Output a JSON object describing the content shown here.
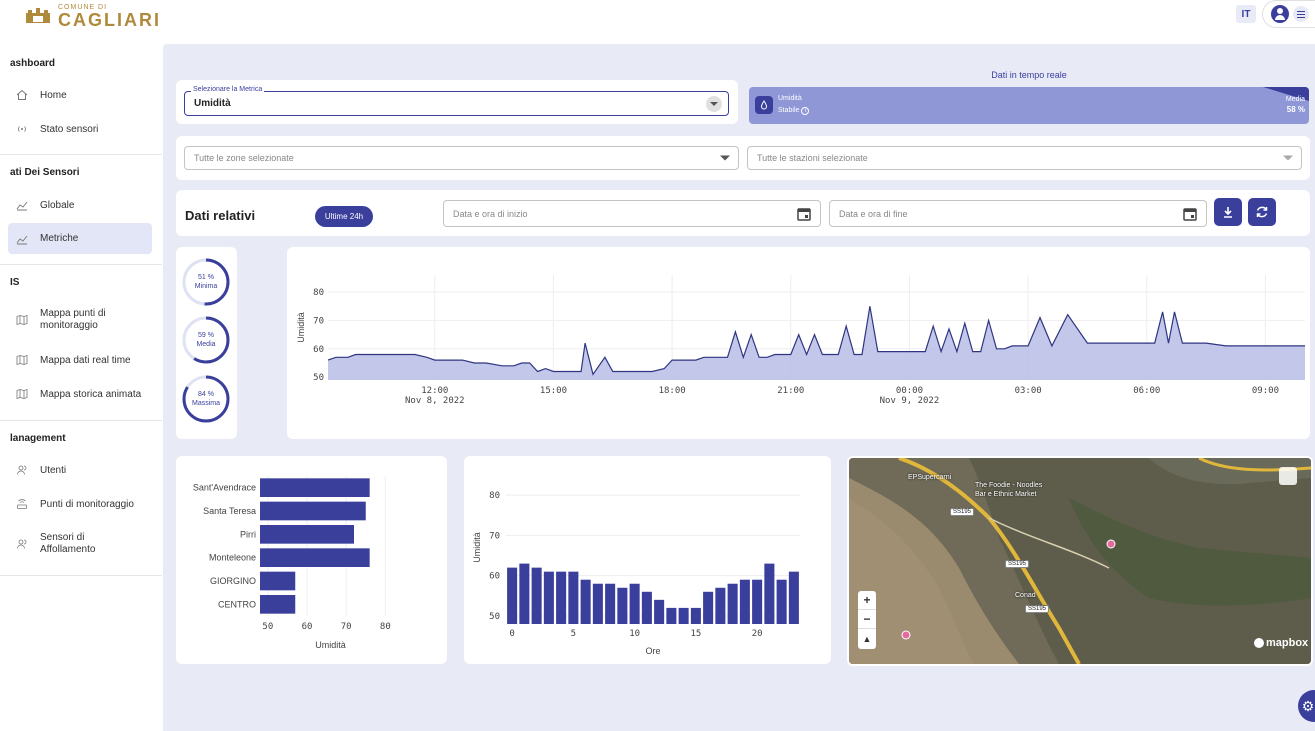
{
  "header": {
    "logo_small": "COMUNE DI",
    "logo_big": "CAGLIARI",
    "lang": "IT"
  },
  "sidebar": {
    "sections": [
      {
        "title": "ashboard"
      },
      {
        "title": "ati Dei Sensori"
      },
      {
        "title": "IS"
      },
      {
        "title": "lanagement"
      }
    ],
    "items": [
      {
        "label": "Home",
        "icon": "home-icon"
      },
      {
        "label": "Stato sensori",
        "icon": "signal-icon"
      },
      {
        "label": "Globale",
        "icon": "chart-icon"
      },
      {
        "label": "Metriche",
        "icon": "chart-icon"
      },
      {
        "label": "Mappa punti di monitoraggio",
        "icon": "map-icon"
      },
      {
        "label": "Mappa dati real time",
        "icon": "map-icon"
      },
      {
        "label": "Mappa storica animata",
        "icon": "map-icon"
      },
      {
        "label": "Utenti",
        "icon": "users-icon"
      },
      {
        "label": "Punti di monitoraggio",
        "icon": "router-icon"
      },
      {
        "label": "Sensori di Affollamento",
        "icon": "users-icon"
      }
    ]
  },
  "filters": {
    "metric_label": "Selezionare la Metrica",
    "metric_value": "Umidità",
    "zones_placeholder": "Tutte le zone selezionate",
    "stations_placeholder": "Tutte le stazioni selezionate"
  },
  "realtime": {
    "title": "Dati in tempo reale",
    "metric": "Umidità",
    "status": "Stabile",
    "media_label": "Media",
    "media_value": "58 %"
  },
  "range": {
    "title": "Dati relativi",
    "chip": "Ultime 24h",
    "start_placeholder": "Data e ora di inizio",
    "end_placeholder": "Data e ora di fine"
  },
  "stats": [
    {
      "value": "51 %",
      "label": "Minima",
      "fraction": 0.51
    },
    {
      "value": "59 %",
      "label": "Media",
      "fraction": 0.59
    },
    {
      "value": "84 %",
      "label": "Massima",
      "fraction": 0.84
    }
  ],
  "map": {
    "labels": [
      "EPSupercarni",
      "The Foodie - Noodles Bar e Ethnic Market",
      "Conad"
    ],
    "roads": [
      "SS195",
      "SS195",
      "SS195"
    ],
    "brand": "mapbox"
  },
  "chart_data": [
    {
      "type": "area",
      "ylabel": "Umidità",
      "ylim": [
        49,
        86
      ],
      "yticks": [
        50,
        60,
        70,
        80
      ],
      "x_range_hours": [
        9.3,
        34.0
      ],
      "xticks": [
        {
          "h": 12,
          "label": "12:00",
          "sub": "Nov 8, 2022"
        },
        {
          "h": 15,
          "label": "15:00",
          "sub": ""
        },
        {
          "h": 18,
          "label": "18:00",
          "sub": ""
        },
        {
          "h": 21,
          "label": "21:00",
          "sub": ""
        },
        {
          "h": 24,
          "label": "00:00",
          "sub": "Nov 9, 2022"
        },
        {
          "h": 27,
          "label": "03:00",
          "sub": ""
        },
        {
          "h": 30,
          "label": "06:00",
          "sub": ""
        },
        {
          "h": 33,
          "label": "09:00",
          "sub": ""
        }
      ],
      "x_hours": [
        9.3,
        9.5,
        9.8,
        10.0,
        10.3,
        10.7,
        11.0,
        11.5,
        11.8,
        12.0,
        12.3,
        12.7,
        13.0,
        13.3,
        13.7,
        14.0,
        14.2,
        14.4,
        14.6,
        14.8,
        15.0,
        15.3,
        15.5,
        15.7,
        15.8,
        16.0,
        16.3,
        16.5,
        16.8,
        17.0,
        17.3,
        17.5,
        17.8,
        18.0,
        18.2,
        18.4,
        18.6,
        18.8,
        19.0,
        19.2,
        19.4,
        19.6,
        19.8,
        20.0,
        20.2,
        20.4,
        20.6,
        20.8,
        21.0,
        21.2,
        21.4,
        21.6,
        21.8,
        22.0,
        22.2,
        22.4,
        22.6,
        22.8,
        23.0,
        23.2,
        23.4,
        23.6,
        23.8,
        24.0,
        24.2,
        24.4,
        24.6,
        24.8,
        25.0,
        25.2,
        25.4,
        25.6,
        25.8,
        26.0,
        26.2,
        26.4,
        26.6,
        26.8,
        27.0,
        27.3,
        27.6,
        28.0,
        28.5,
        29.0,
        29.5,
        29.9,
        30.2,
        30.4,
        30.55,
        30.7,
        30.9,
        31.2,
        31.5,
        32.0,
        32.5,
        33.0,
        33.5,
        34.0
      ],
      "values": [
        56,
        57,
        57,
        58,
        58,
        58,
        58,
        58,
        57,
        56,
        56,
        56,
        55,
        55,
        54,
        54,
        55,
        55,
        52,
        53,
        52,
        52,
        52,
        52,
        62,
        51,
        57,
        52,
        52,
        52,
        52,
        52,
        53,
        56,
        56,
        56,
        56,
        57,
        57,
        57,
        57,
        66,
        57,
        65,
        57,
        57,
        58,
        58,
        58,
        65,
        58,
        65,
        58,
        58,
        58,
        68,
        58,
        58,
        75,
        59,
        59,
        59,
        59,
        59,
        59,
        59,
        68,
        59,
        67,
        59,
        69,
        59,
        59,
        70,
        60,
        60,
        61,
        61,
        61,
        71,
        61,
        72,
        62,
        62,
        62,
        62,
        62,
        73,
        62,
        73,
        62,
        62,
        62,
        61,
        61,
        61,
        61,
        61,
        60,
        84,
        60,
        59,
        59,
        58,
        58,
        58,
        58,
        58,
        58,
        58
      ],
      "xlabels_hours": []
    },
    {
      "type": "bar",
      "orientation": "horizontal",
      "categories": [
        "Sant'Avendrace",
        "Santa Teresa",
        "Pirri",
        "Monteleone",
        "GIORGINO",
        "CENTRO"
      ],
      "values": [
        76,
        75,
        72,
        76,
        57,
        57
      ],
      "xlabel": "Umidità",
      "xlim": [
        48,
        84
      ],
      "xticks": [
        50,
        60,
        70,
        80
      ]
    },
    {
      "type": "bar",
      "categories": [
        0,
        1,
        2,
        3,
        4,
        5,
        6,
        7,
        8,
        9,
        10,
        11,
        12,
        13,
        14,
        15,
        16,
        17,
        18,
        19,
        20,
        21,
        22,
        23
      ],
      "values": [
        62,
        63,
        62,
        61,
        61,
        61,
        59,
        58,
        58,
        57,
        58,
        56,
        54,
        52,
        52,
        52,
        56,
        57,
        58,
        59,
        59,
        63,
        59,
        61
      ],
      "xlabel": "Ore",
      "ylabel": "Umidità",
      "ylim": [
        48,
        86
      ],
      "yticks": [
        50,
        60,
        70,
        80
      ],
      "xticks": [
        0,
        5,
        10,
        15,
        20
      ]
    }
  ]
}
